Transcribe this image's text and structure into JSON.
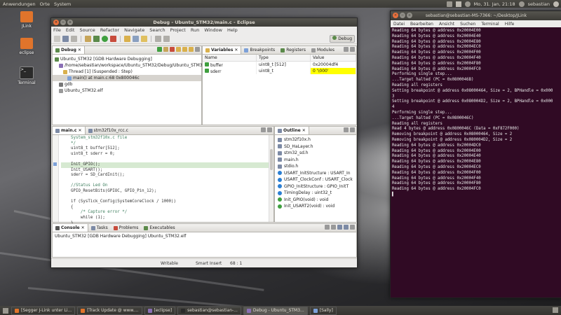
{
  "top_panel": {
    "menus": [
      "Anwendungen",
      "Orte",
      "System"
    ],
    "datetime": "Mo, 31. Jan, 21:18",
    "user": "sebastian"
  },
  "desktop_icons": [
    {
      "label": "JLink",
      "color": "#e0742b"
    },
    {
      "label": "eclipse",
      "color": "#e0742b"
    },
    {
      "label": "Terminal",
      "color": "#2a2a2a"
    }
  ],
  "eclipse": {
    "title": "Debug - Ubuntu_STM32/main.c - Eclipse",
    "menu": [
      "File",
      "Edit",
      "Source",
      "Refactor",
      "Navigate",
      "Search",
      "Project",
      "Run",
      "Window",
      "Help"
    ],
    "perspective": "Debug",
    "debug_view": {
      "tab": "Debug",
      "rows": [
        {
          "indent": 0,
          "text": "Ubuntu_STM32 [GDB Hardware Debugging]"
        },
        {
          "indent": 1,
          "text": "/home/sebastian/workspace/Ubuntu_STM32/Debug/Ubuntu_STM32..."
        },
        {
          "indent": 2,
          "text": "Thread [1] (Suspended : Step)"
        },
        {
          "indent": 3,
          "text": "main() at main.c:68 0x800046c",
          "selected": true
        },
        {
          "indent": 1,
          "text": "gdb"
        },
        {
          "indent": 1,
          "text": "Ubuntu_STM32.elf"
        }
      ]
    },
    "variables_view": {
      "tabs": [
        "Variables",
        "Breakpoints",
        "Registers",
        "Modules"
      ],
      "columns": [
        "Name",
        "Type",
        "Value"
      ],
      "rows": [
        {
          "name": "buffer",
          "type": "uint8_t [512]",
          "value": "0x20004df4",
          "highlight": false
        },
        {
          "name": "sderr",
          "type": "uint8_t",
          "value": "0 '\\000'",
          "highlight": true
        }
      ]
    },
    "editor": {
      "tabs": [
        "main.c",
        "stm32f10x_rcc.c"
      ],
      "lines": [
        {
          "text": "    System_stm32f10x.c file",
          "cls": "cm"
        },
        {
          "text": "    */",
          "cls": "cm"
        },
        {
          "text": "    uint8_t buffer[512];",
          "cls": ""
        },
        {
          "text": "    uint8_t sderr = 0;",
          "cls": ""
        },
        {
          "text": "",
          "cls": ""
        },
        {
          "text": "    Init_GPIO();",
          "cls": "",
          "current": true
        },
        {
          "text": "    Init_USART();",
          "cls": ""
        },
        {
          "text": "    sderr = SD_CardInit();",
          "cls": ""
        },
        {
          "text": "",
          "cls": ""
        },
        {
          "text": "    //Status Led On",
          "cls": "cm"
        },
        {
          "text": "    GPIO_ResetBits(GPIOC, GPIO_Pin_12);",
          "cls": ""
        },
        {
          "text": "",
          "cls": ""
        },
        {
          "text": "    if (SysTick_Config(SystemCoreClock / 1000))",
          "cls": ""
        },
        {
          "text": "    {",
          "cls": ""
        },
        {
          "text": "        /* Capture error */",
          "cls": "cm"
        },
        {
          "text": "        while (1);",
          "cls": ""
        },
        {
          "text": "    }",
          "cls": ""
        }
      ]
    },
    "outline": {
      "tab": "Outline",
      "items": [
        "stm32f10x.h",
        "SD_HaLayer.h",
        "stm32_sd.h",
        "main.h",
        "stdio.h",
        "USART_InitStructure : USART_In",
        "USART_ClockConf : USART_Clock",
        "GPIO_InitStructure : GPIO_InitT",
        "TimingDelay : uint32_t",
        "Init_GPIO(void) : void",
        "Init_USART2(void) : void"
      ]
    },
    "console": {
      "tabs": [
        "Console",
        "Tasks",
        "Problems",
        "Executables"
      ],
      "text": "Ubuntu_STM32 [GDB Hardware Debugging] Ubuntu_STM32.elf"
    },
    "status": {
      "writable": "Writable",
      "insert": "Smart Insert",
      "position": "68 : 1"
    }
  },
  "terminal": {
    "title": "sebastian@sebastian-MS-7366: ~/Desktop/JLink",
    "menu": [
      "Datei",
      "Bearbeiten",
      "Ansicht",
      "Suchen",
      "Terminal",
      "Hilfe"
    ],
    "lines": [
      "Reading 64 bytes @ address 0x20004E00",
      "Reading 64 bytes @ address 0x20004E40",
      "Reading 64 bytes @ address 0x20004E80",
      "Reading 64 bytes @ address 0x20004EC0",
      "Reading 64 bytes @ address 0x20004F00",
      "Reading 64 bytes @ address 0x20004F40",
      "Reading 64 bytes @ address 0x20004F80",
      "Reading 64 bytes @ address 0x20004FC0",
      "Performing single step...",
      "...Target halted (PC = 0x0800046B)",
      "Reading all registers",
      "Setting breakpoint @ address 0x08000464, Size = 2, BPHandle = 0x000",
      "3",
      "Setting breakpoint @ address 0x080004D2, Size = 2, BPHandle = 0x000",
      "4",
      "Performing single step...",
      "...Target halted (PC = 0x0800046C)",
      "Reading all registers",
      "Read 4 bytes @ address 0x0800046C (Data = 0xF872F000)",
      "Removing breakpoint @ address 0x08000464, Size = 2",
      "Removing breakpoint @ address 0x080004D2, Size = 2",
      "Reading 64 bytes @ address 0x20004DC0",
      "Reading 64 bytes @ address 0x20004E00",
      "Reading 64 bytes @ address 0x20004E40",
      "Reading 64 bytes @ address 0x20004E80",
      "Reading 64 bytes @ address 0x20004EC0",
      "Reading 64 bytes @ address 0x20004F00",
      "Reading 64 bytes @ address 0x20004F40",
      "Reading 64 bytes @ address 0x20004F80",
      "Reading 64 bytes @ address 0x20004FC0",
      "▌"
    ]
  },
  "taskbar": {
    "items": [
      {
        "label": "[Segger J-Link unter Li...",
        "active": false
      },
      {
        "label": "[Track Update @ www....",
        "active": false
      },
      {
        "label": "[eclipse]",
        "active": false
      },
      {
        "label": "sebastian@sebastian-...",
        "active": false
      },
      {
        "label": "Debug - Ubuntu_STM3...",
        "active": true
      },
      {
        "label": "[Sally]",
        "active": false
      }
    ]
  }
}
